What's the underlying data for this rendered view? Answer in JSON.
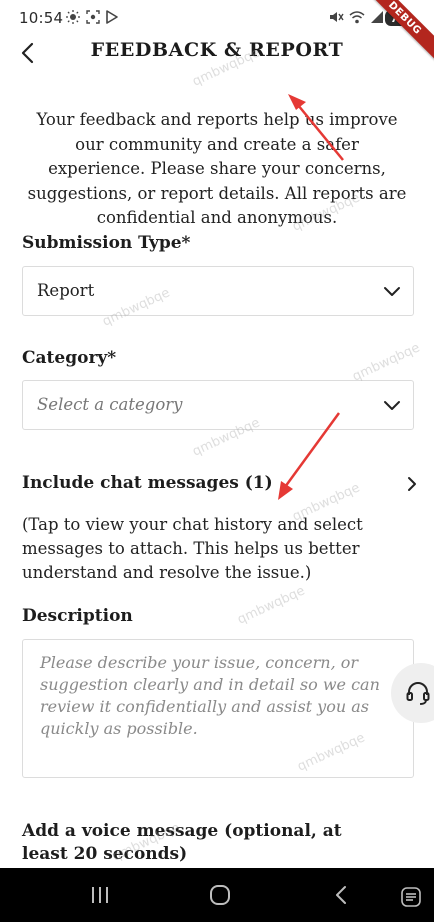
{
  "status_bar": {
    "time": "10:54",
    "battery": "75",
    "icons": [
      "brightness-icon",
      "screen-record-icon",
      "play-store-icon",
      "mute-icon",
      "wifi-icon",
      "signal-icon",
      "battery-icon"
    ]
  },
  "debug_ribbon": "DEBUG",
  "header": {
    "title": "FEEDBACK & REPORT"
  },
  "intro_text": "Your feedback and reports help us improve our community and create a safer experience. Please share your concerns, suggestions, or report details. All reports are confidential and anonymous.",
  "submission_type": {
    "label": "Submission Type*",
    "value": "Report"
  },
  "category": {
    "label": "Category*",
    "placeholder": "Select a category"
  },
  "chat_messages": {
    "label": "Include chat messages (1)",
    "help": "(Tap to view your chat history and select messages to attach. This helps us better understand and resolve the issue.)"
  },
  "description": {
    "label": "Description",
    "placeholder": "Please describe your issue, concern, or suggestion clearly and in detail so we can review it confidentially and assist you as quickly as possible."
  },
  "voice_message": {
    "label": "Add a voice message (optional, at least 20 seconds)"
  },
  "watermark_text": "qmbwqbqe",
  "colors": {
    "annotation_arrow": "#e53935",
    "debug_ribbon": "#b3261e",
    "nav_bar": "#000000"
  }
}
